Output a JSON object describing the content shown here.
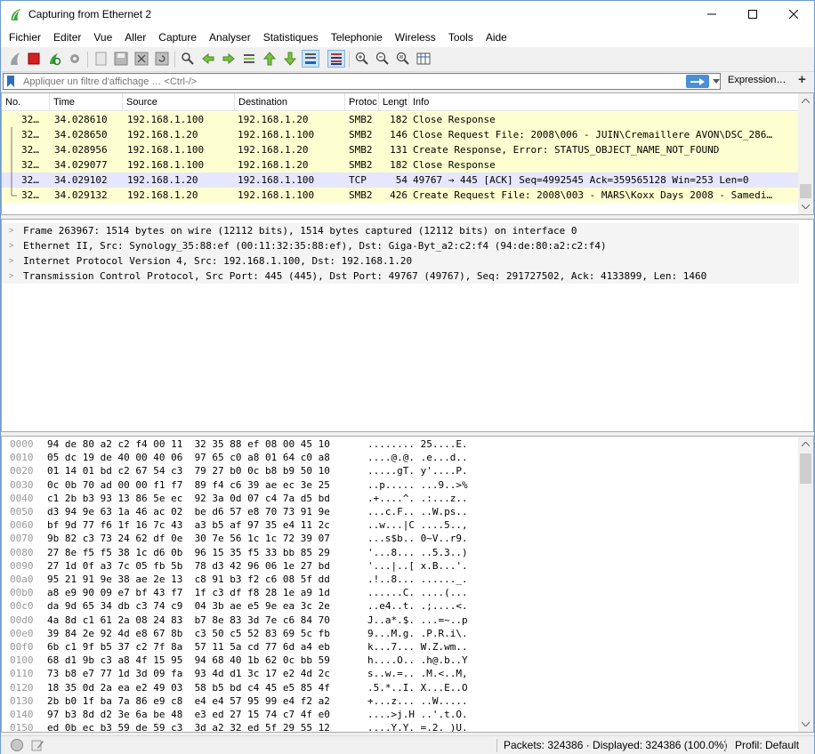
{
  "window": {
    "title": "Capturing from Ethernet 2"
  },
  "menu": [
    "Fichier",
    "Editer",
    "Vue",
    "Aller",
    "Capture",
    "Analyser",
    "Statistiques",
    "Telephonie",
    "Wireless",
    "Tools",
    "Aide"
  ],
  "filter": {
    "placeholder": "Appliquer un filtre d'affichage … <Ctrl-/>",
    "expression_label": "Expression…",
    "plus_label": "+"
  },
  "packet_list": {
    "columns": [
      "No.",
      "Time",
      "Source",
      "Destination",
      "Protoc",
      "Lengt",
      "Info"
    ],
    "rows": [
      {
        "no": "32…",
        "time": "34.028610",
        "source": "192.168.1.100",
        "destination": "192.168.1.20",
        "protocol": "SMB2",
        "length": "182",
        "info": "Close Response"
      },
      {
        "no": "32…",
        "time": "34.028650",
        "source": "192.168.1.20",
        "destination": "192.168.1.100",
        "protocol": "SMB2",
        "length": "146",
        "info": "Close Request File: 2008\\006 - JUIN\\Cremaillere AVON\\DSC_286…"
      },
      {
        "no": "32…",
        "time": "34.028956",
        "source": "192.168.1.100",
        "destination": "192.168.1.20",
        "protocol": "SMB2",
        "length": "131",
        "info": "Create Response, Error: STATUS_OBJECT_NAME_NOT_FOUND"
      },
      {
        "no": "32…",
        "time": "34.029077",
        "source": "192.168.1.100",
        "destination": "192.168.1.20",
        "protocol": "SMB2",
        "length": "182",
        "info": "Close Response"
      },
      {
        "no": "32…",
        "time": "34.029102",
        "source": "192.168.1.20",
        "destination": "192.168.1.100",
        "protocol": "TCP",
        "length": "54",
        "info": "49767 → 445 [ACK] Seq=4992545 Ack=359565128 Win=253 Len=0"
      },
      {
        "no": "32…",
        "time": "34.029132",
        "source": "192.168.1.20",
        "destination": "192.168.1.100",
        "protocol": "SMB2",
        "length": "426",
        "info": "Create Request File: 2008\\003 - MARS\\Koxx Days 2008 - Samedi…"
      }
    ]
  },
  "details": [
    "Frame 263967: 1514 bytes on wire (12112 bits), 1514 bytes captured (12112 bits) on interface 0",
    "Ethernet II, Src: Synology_35:88:ef (00:11:32:35:88:ef), Dst: Giga-Byt_a2:c2:f4 (94:de:80:a2:c2:f4)",
    "Internet Protocol Version 4, Src: 192.168.1.100, Dst: 192.168.1.20",
    "Transmission Control Protocol, Src Port: 445 (445), Dst Port: 49767 (49767), Seq: 291727502, Ack: 4133899, Len: 1460"
  ],
  "bytes": [
    {
      "offset": "0000",
      "hex": "94 de 80 a2 c2 f4 00 11  32 35 88 ef 08 00 45 10",
      "ascii": "........ 25....E."
    },
    {
      "offset": "0010",
      "hex": "05 dc 19 de 40 00 40 06  97 65 c0 a8 01 64 c0 a8",
      "ascii": "....@.@. .e...d.."
    },
    {
      "offset": "0020",
      "hex": "01 14 01 bd c2 67 54 c3  79 27 b0 0c b8 b9 50 10",
      "ascii": ".....gT. y'....P."
    },
    {
      "offset": "0030",
      "hex": "0c 0b 70 ad 00 00 f1 f7  89 f4 c6 39 ae ec 3e 25",
      "ascii": "..p..... ...9..>%"
    },
    {
      "offset": "0040",
      "hex": "c1 2b b3 93 13 86 5e ec  92 3a 0d 07 c4 7a d5 bd",
      "ascii": ".+....^. .:...z.."
    },
    {
      "offset": "0050",
      "hex": "d3 94 9e 63 1a 46 ac 02  be d6 57 e8 70 73 91 9e",
      "ascii": "...c.F.. ..W.ps.."
    },
    {
      "offset": "0060",
      "hex": "bf 9d 77 f6 1f 16 7c 43  a3 b5 af 97 35 e4 11 2c",
      "ascii": "..w...|C ....5..,"
    },
    {
      "offset": "0070",
      "hex": "9b 82 c3 73 24 62 df 0e  30 7e 56 1c 1c 72 39 07",
      "ascii": "...s$b.. 0~V..r9."
    },
    {
      "offset": "0080",
      "hex": "27 8e f5 f5 38 1c d6 0b  96 15 35 f5 33 bb 85 29",
      "ascii": "'...8... ..5.3..)"
    },
    {
      "offset": "0090",
      "hex": "27 1d 0f a3 7c 05 fb 5b  78 d3 42 96 06 1e 27 bd",
      "ascii": "'...|..[ x.B...'."
    },
    {
      "offset": "00a0",
      "hex": "95 21 91 9e 38 ae 2e 13  c8 91 b3 f2 c6 08 5f dd",
      "ascii": ".!..8... ......_."
    },
    {
      "offset": "00b0",
      "hex": "a8 e9 90 09 e7 bf 43 f7  1f c3 df f8 28 1e a9 1d",
      "ascii": "......C. ....(..."
    },
    {
      "offset": "00c0",
      "hex": "da 9d 65 34 db c3 74 c9  04 3b ae e5 9e ea 3c 2e",
      "ascii": "..e4..t. .;....<."
    },
    {
      "offset": "00d0",
      "hex": "4a 8d c1 61 2a 08 24 83  b7 8e 83 3d 7e c6 84 70",
      "ascii": "J..a*.$. ...=~..p"
    },
    {
      "offset": "00e0",
      "hex": "39 84 2e 92 4d e8 67 8b  c3 50 c5 52 83 69 5c fb",
      "ascii": "9...M.g. .P.R.i\\."
    },
    {
      "offset": "00f0",
      "hex": "6b c1 9f b5 37 c2 7f 8a  57 11 5a cd 77 6d a4 eb",
      "ascii": "k...7... W.Z.wm.."
    },
    {
      "offset": "0100",
      "hex": "68 d1 9b c3 a8 4f 15 95  94 68 40 1b 62 0c bb 59",
      "ascii": "h....O.. .h@.b..Y"
    },
    {
      "offset": "0110",
      "hex": "73 b8 e7 77 1d 3d 09 fa  93 4d d1 3c 17 e2 4d 2c",
      "ascii": "s..w.=.. .M.<..M,"
    },
    {
      "offset": "0120",
      "hex": "18 35 0d 2a ea e2 49 03  58 b5 bd c4 45 e5 85 4f",
      "ascii": ".5.*..I. X...E..O"
    },
    {
      "offset": "0130",
      "hex": "2b b0 1f ba 7a 86 e9 c8  e4 e4 57 95 99 e4 f2 a2",
      "ascii": "+...z... ..W....."
    },
    {
      "offset": "0140",
      "hex": "97 b3 8d d2 3e 6a be 48  e3 ed 27 15 74 c7 4f e0",
      "ascii": "....>j.H ..'.t.O."
    },
    {
      "offset": "0150",
      "hex": "ed 0b ec b3 59 de 59 c3  3d a2 32 ed 5f 29 55 12",
      "ascii": "....Y.Y. =.2._)U."
    }
  ],
  "status": {
    "packets": "Packets: 324386 · Displayed: 324386 (100.0%)",
    "profile": "Profil: Default"
  },
  "colors": {
    "smb_row": "#feffd0",
    "tcp_row": "#e7e6ff",
    "accent": "#4a8fd8"
  }
}
